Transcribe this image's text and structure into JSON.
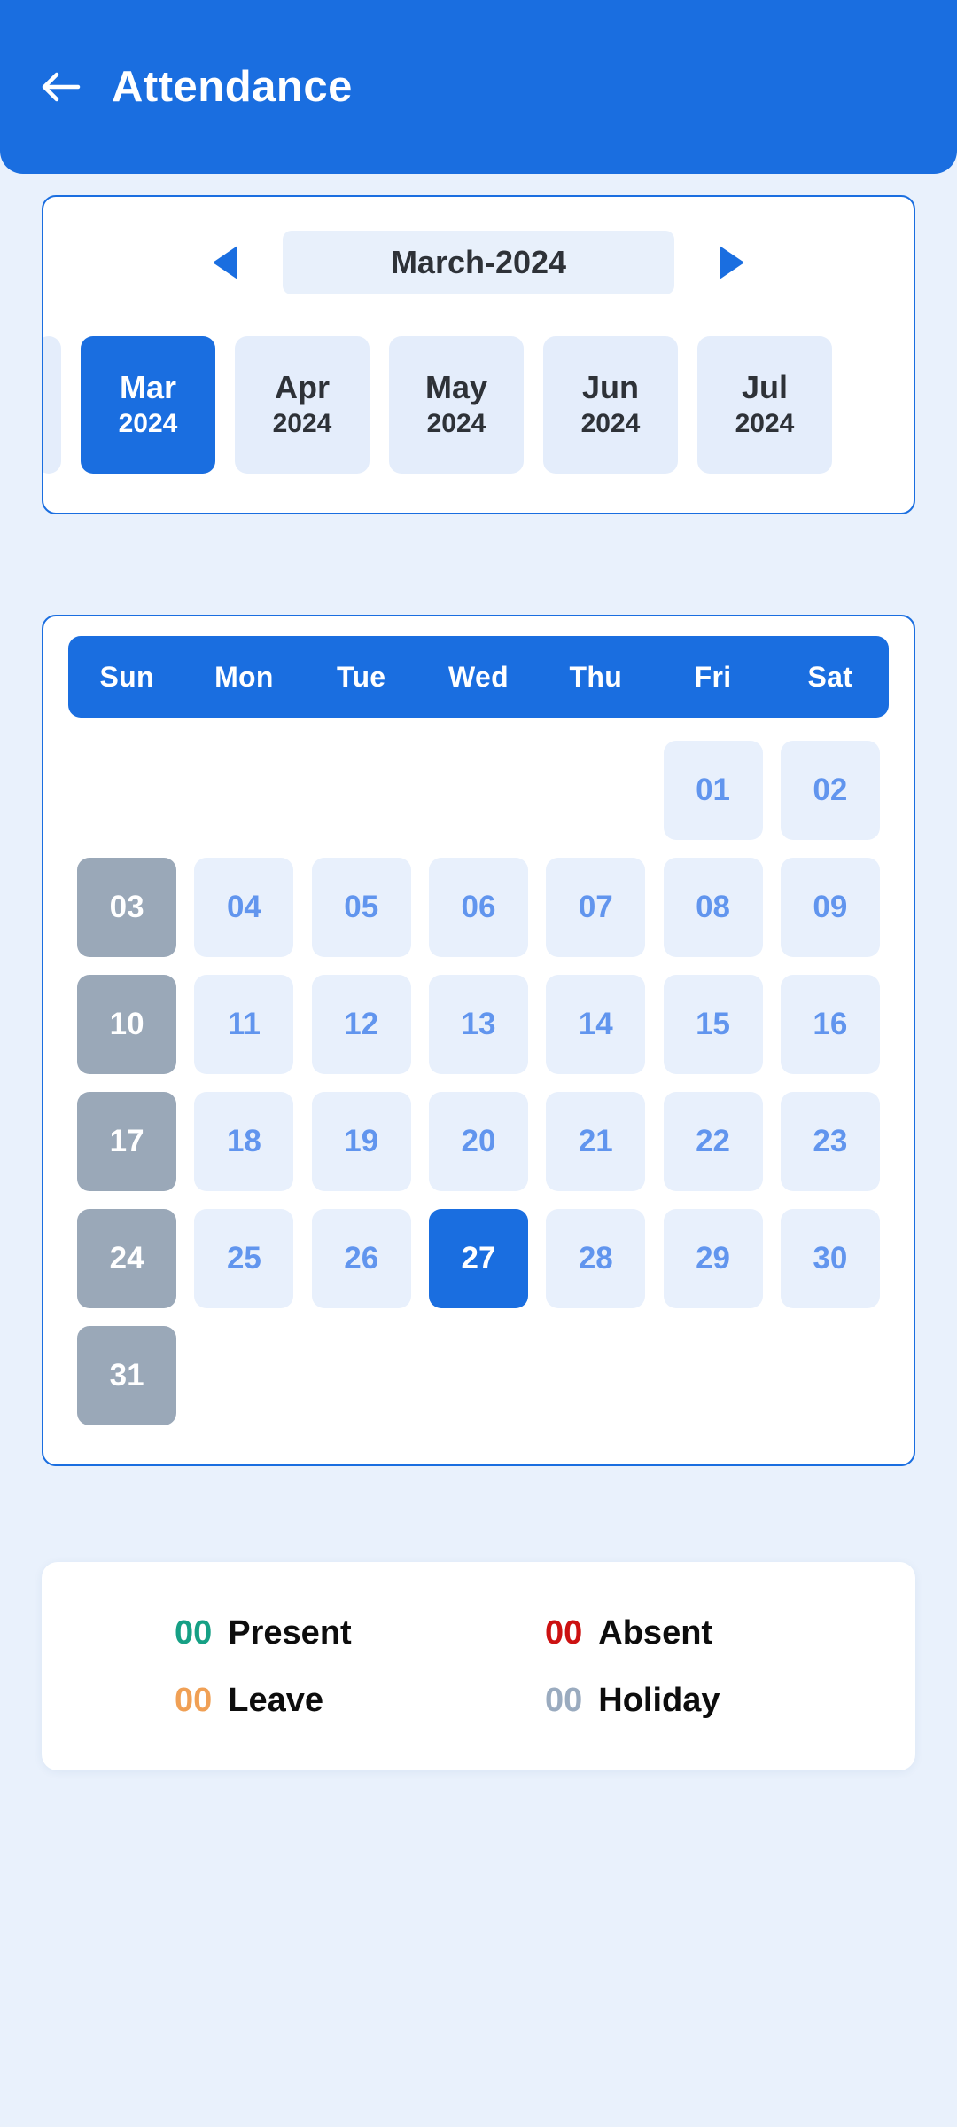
{
  "header": {
    "back_icon": "arrow-left-icon",
    "title": "Attendance",
    "bg_color": "#1a6ee0"
  },
  "month_selector": {
    "prev_icon": "triangle-left-icon",
    "next_icon": "triangle-right-icon",
    "current_month_label": "March-2024",
    "chips": [
      {
        "name": "",
        "year": "",
        "selected": false,
        "partial": true
      },
      {
        "name": "Mar",
        "year": "2024",
        "selected": true,
        "partial": false
      },
      {
        "name": "Apr",
        "year": "2024",
        "selected": false,
        "partial": false
      },
      {
        "name": "May",
        "year": "2024",
        "selected": false,
        "partial": false
      },
      {
        "name": "Jun",
        "year": "2024",
        "selected": false,
        "partial": false
      },
      {
        "name": "Jul",
        "year": "2024",
        "selected": false,
        "partial": false
      }
    ],
    "selected_color": "#1a6ee0",
    "chip_color": "#e4edfb"
  },
  "calendar": {
    "weekday_headers": [
      "Sun",
      "Mon",
      "Tue",
      "Wed",
      "Thu",
      "Fri",
      "Sat"
    ],
    "header_bg": "#1a6ee0",
    "cells": [
      {
        "label": "",
        "type": "empty"
      },
      {
        "label": "",
        "type": "empty"
      },
      {
        "label": "",
        "type": "empty"
      },
      {
        "label": "",
        "type": "empty"
      },
      {
        "label": "",
        "type": "empty"
      },
      {
        "label": "01",
        "type": "normal"
      },
      {
        "label": "02",
        "type": "normal"
      },
      {
        "label": "03",
        "type": "sunday"
      },
      {
        "label": "04",
        "type": "normal"
      },
      {
        "label": "05",
        "type": "normal"
      },
      {
        "label": "06",
        "type": "normal"
      },
      {
        "label": "07",
        "type": "normal"
      },
      {
        "label": "08",
        "type": "normal"
      },
      {
        "label": "09",
        "type": "normal"
      },
      {
        "label": "10",
        "type": "sunday"
      },
      {
        "label": "11",
        "type": "normal"
      },
      {
        "label": "12",
        "type": "normal"
      },
      {
        "label": "13",
        "type": "normal"
      },
      {
        "label": "14",
        "type": "normal"
      },
      {
        "label": "15",
        "type": "normal"
      },
      {
        "label": "16",
        "type": "normal"
      },
      {
        "label": "17",
        "type": "sunday"
      },
      {
        "label": "18",
        "type": "normal"
      },
      {
        "label": "19",
        "type": "normal"
      },
      {
        "label": "20",
        "type": "normal"
      },
      {
        "label": "21",
        "type": "normal"
      },
      {
        "label": "22",
        "type": "normal"
      },
      {
        "label": "23",
        "type": "normal"
      },
      {
        "label": "24",
        "type": "sunday"
      },
      {
        "label": "25",
        "type": "normal"
      },
      {
        "label": "26",
        "type": "normal"
      },
      {
        "label": "27",
        "type": "selected"
      },
      {
        "label": "28",
        "type": "normal"
      },
      {
        "label": "29",
        "type": "normal"
      },
      {
        "label": "30",
        "type": "normal"
      },
      {
        "label": "31",
        "type": "sunday"
      },
      {
        "label": "",
        "type": "empty"
      },
      {
        "label": "",
        "type": "empty"
      },
      {
        "label": "",
        "type": "empty"
      },
      {
        "label": "",
        "type": "empty"
      },
      {
        "label": "",
        "type": "empty"
      },
      {
        "label": "",
        "type": "empty"
      }
    ],
    "colors": {
      "normal_bg": "#e8f0fc",
      "normal_text": "#6195ee",
      "sunday_bg": "#9aa8b8",
      "sunday_text": "#ffffff",
      "selected_bg": "#1a6ee0",
      "selected_text": "#ffffff"
    }
  },
  "legend": {
    "items": [
      {
        "count": "00",
        "label": "Present",
        "color": "#16a085"
      },
      {
        "count": "00",
        "label": "Absent",
        "color": "#cc1111"
      },
      {
        "count": "00",
        "label": "Leave",
        "color": "#f0a055"
      },
      {
        "count": "00",
        "label": "Holiday",
        "color": "#9aabbf"
      }
    ]
  },
  "page": {
    "background": "#e9f1fc"
  }
}
